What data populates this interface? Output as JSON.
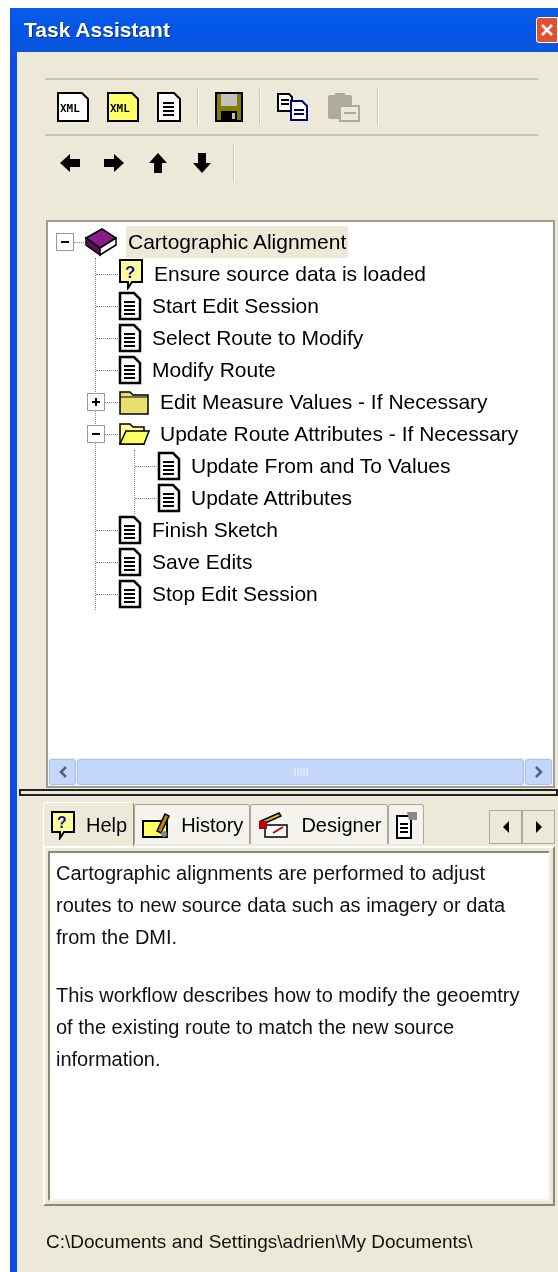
{
  "window": {
    "title": "Task Assistant"
  },
  "toolbars": [
    [
      {
        "kind": "xml",
        "icon_text": "XML",
        "disabled": false
      },
      {
        "kind": "xml_yellow",
        "icon_text": "XML",
        "disabled": false
      },
      {
        "kind": "page",
        "disabled": false
      },
      {
        "kind": "sep"
      },
      {
        "kind": "save",
        "disabled": false
      },
      {
        "kind": "sep"
      },
      {
        "kind": "copy",
        "disabled": false
      },
      {
        "kind": "paste",
        "disabled": true
      },
      {
        "kind": "sep"
      }
    ],
    [
      {
        "kind": "left",
        "disabled": false
      },
      {
        "kind": "right",
        "disabled": false
      },
      {
        "kind": "up",
        "disabled": false
      },
      {
        "kind": "down",
        "disabled": false
      },
      {
        "kind": "sep"
      }
    ]
  ],
  "tree": {
    "items": [
      {
        "kind": "book",
        "label": "Cartographic Alignment",
        "selected": true,
        "expanded": true,
        "children": [
          {
            "kind": "help",
            "icon_text": "?",
            "label": "Ensure source data is loaded",
            "selected": false
          },
          {
            "kind": "page",
            "label": "Start Edit Session",
            "selected": false
          },
          {
            "kind": "page",
            "label": "Select Route to Modify",
            "selected": false
          },
          {
            "kind": "page",
            "label": "Modify Route",
            "selected": false
          },
          {
            "kind": "folder",
            "label": "Edit Measure Values - If Necessary",
            "selected": false,
            "expanded": false
          },
          {
            "kind": "folder",
            "label": "Update Route Attributes - If Necessary",
            "selected": false,
            "expanded": true,
            "children": [
              {
                "kind": "page",
                "label": "Update From and To Values",
                "selected": false
              },
              {
                "kind": "page",
                "label": "Update Attributes",
                "selected": false
              }
            ]
          },
          {
            "kind": "page",
            "label": "Finish Sketch",
            "selected": false
          },
          {
            "kind": "page",
            "label": "Save Edits",
            "selected": false
          },
          {
            "kind": "page",
            "label": "Stop Edit Session",
            "selected": false
          }
        ]
      }
    ]
  },
  "tabs": [
    {
      "kind": "help",
      "icon_text": "?",
      "label": "Help",
      "selected": true
    },
    {
      "kind": "history",
      "label": "History",
      "selected": false
    },
    {
      "kind": "designer",
      "label": "Designer",
      "selected": false
    },
    {
      "kind": "properties",
      "selected": false
    }
  ],
  "help_text": [
    "Cartographic alignments are performed to adjust routes to new source data such as imagery or data from the DMI.",
    "This workflow describes how to modify the geoemtry of the existing route to match the new source information."
  ],
  "status_bar": "C:\\Documents and Settings\\adrien\\My Documents\\"
}
